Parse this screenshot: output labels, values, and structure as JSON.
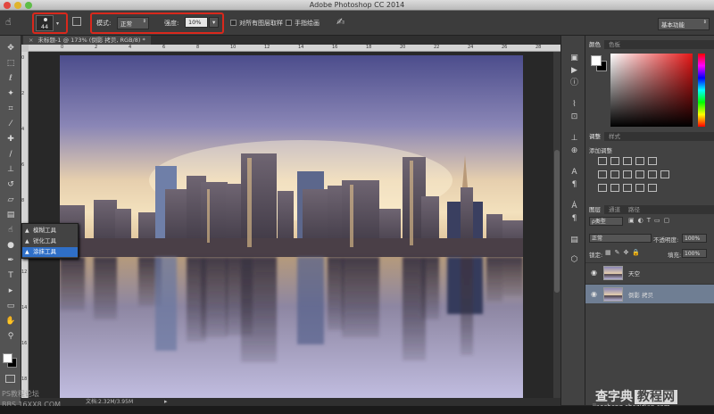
{
  "app": {
    "title": "Adobe Photoshop CC 2014",
    "workspace": "基本功能"
  },
  "options_bar": {
    "brush_size": "44",
    "mode_label": "模式:",
    "mode_value": "正常",
    "strength_label": "强度:",
    "strength_value": "10%",
    "sample_all_label": "对所有图层取样",
    "finger_paint_label": "手指绘画",
    "highlight_color": "#d9281c"
  },
  "document": {
    "tab_label": "未标题-1 @ 173% (倒影 拷贝, RGB/8) *",
    "status": "文档:2.32M/3.95M"
  },
  "ruler": {
    "h_ticks": [
      "0",
      "2",
      "4",
      "6",
      "8",
      "10",
      "12",
      "14",
      "16",
      "18",
      "20",
      "22",
      "24",
      "26",
      "28"
    ],
    "v_ticks": [
      "0",
      "2",
      "4",
      "6",
      "8",
      "10",
      "12",
      "14",
      "16",
      "18"
    ]
  },
  "tools": [
    {
      "name": "move-tool-icon",
      "glyph": "✥"
    },
    {
      "name": "marquee-tool-icon",
      "glyph": "⬚"
    },
    {
      "name": "lasso-tool-icon",
      "glyph": "ℓ"
    },
    {
      "name": "magic-wand-tool-icon",
      "glyph": "✦"
    },
    {
      "name": "crop-tool-icon",
      "glyph": "⌗"
    },
    {
      "name": "eyedropper-tool-icon",
      "glyph": "⁄"
    },
    {
      "name": "healing-brush-tool-icon",
      "glyph": "✚"
    },
    {
      "name": "brush-tool-icon",
      "glyph": "/"
    },
    {
      "name": "clone-stamp-tool-icon",
      "glyph": "⊥"
    },
    {
      "name": "history-brush-tool-icon",
      "glyph": "↺"
    },
    {
      "name": "eraser-tool-icon",
      "glyph": "▱"
    },
    {
      "name": "gradient-tool-icon",
      "glyph": "▤"
    },
    {
      "name": "smudge-tool-icon",
      "glyph": "☝"
    },
    {
      "name": "dodge-tool-icon",
      "glyph": "●"
    },
    {
      "name": "pen-tool-icon",
      "glyph": "✒"
    },
    {
      "name": "type-tool-icon",
      "glyph": "T"
    },
    {
      "name": "path-selection-tool-icon",
      "glyph": "▸"
    },
    {
      "name": "rectangle-tool-icon",
      "glyph": "▭"
    },
    {
      "name": "hand-tool-icon",
      "glyph": "✋"
    },
    {
      "name": "zoom-tool-icon",
      "glyph": "⚲"
    }
  ],
  "flyout": {
    "items": [
      "模糊工具",
      "锐化工具",
      "涂抹工具"
    ],
    "selected": "涂抹工具"
  },
  "color_panel": {
    "tabs": [
      "颜色",
      "色板"
    ]
  },
  "adjustments_panel": {
    "tabs": [
      "调整",
      "样式"
    ],
    "heading": "添加调整"
  },
  "layers_panel": {
    "tabs": [
      "图层",
      "通道",
      "路径"
    ],
    "filter_kind": "ρ类型",
    "blend_mode": "正常",
    "opacity_label": "不透明度:",
    "opacity_value": "100%",
    "lock_label": "锁定:",
    "fill_label": "填充:",
    "fill_value": "100%",
    "layers": [
      {
        "name": "天空",
        "selected": false
      },
      {
        "name": "倒影 拷贝",
        "selected": true
      }
    ]
  },
  "watermarks": {
    "ps_forum": "PS教程论坛",
    "ps_forum_url": "BBS.16XX8.COM",
    "site_name": "查字典",
    "site_box": "教程网",
    "site_url": "jiaocheng.chazidian.com"
  },
  "colors": {
    "accent": "#d9281c",
    "layer_selected": "#6f7e93",
    "foreground": "#ffffff",
    "background": "#000000"
  }
}
